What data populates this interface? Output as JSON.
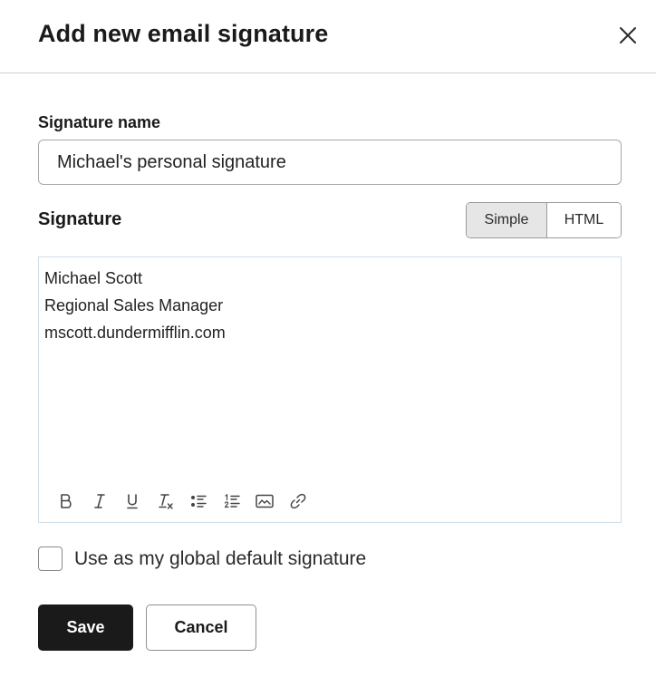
{
  "dialog": {
    "title": "Add new email signature",
    "close_icon": "close-icon"
  },
  "signature_name": {
    "label": "Signature name",
    "value": "Michael's personal signature"
  },
  "signature": {
    "label": "Signature",
    "mode_options": [
      "Simple",
      "HTML"
    ],
    "selected_mode": "Simple",
    "lines": [
      "Michael Scott",
      "Regional Sales Manager",
      "mscott.dundermifflin.com"
    ]
  },
  "toolbar": {
    "tools": [
      "bold-icon",
      "italic-icon",
      "underline-icon",
      "clear-format-icon",
      "bulleted-list-icon",
      "numbered-list-icon",
      "image-icon",
      "link-icon"
    ]
  },
  "default_checkbox": {
    "label": "Use as my global default signature",
    "checked": false
  },
  "actions": {
    "save_label": "Save",
    "cancel_label": "Cancel"
  },
  "colors": {
    "primary_button": "#1a1a1a",
    "toggle_selected_bg": "#e6e6e6",
    "editor_border": "#cfdcea"
  }
}
